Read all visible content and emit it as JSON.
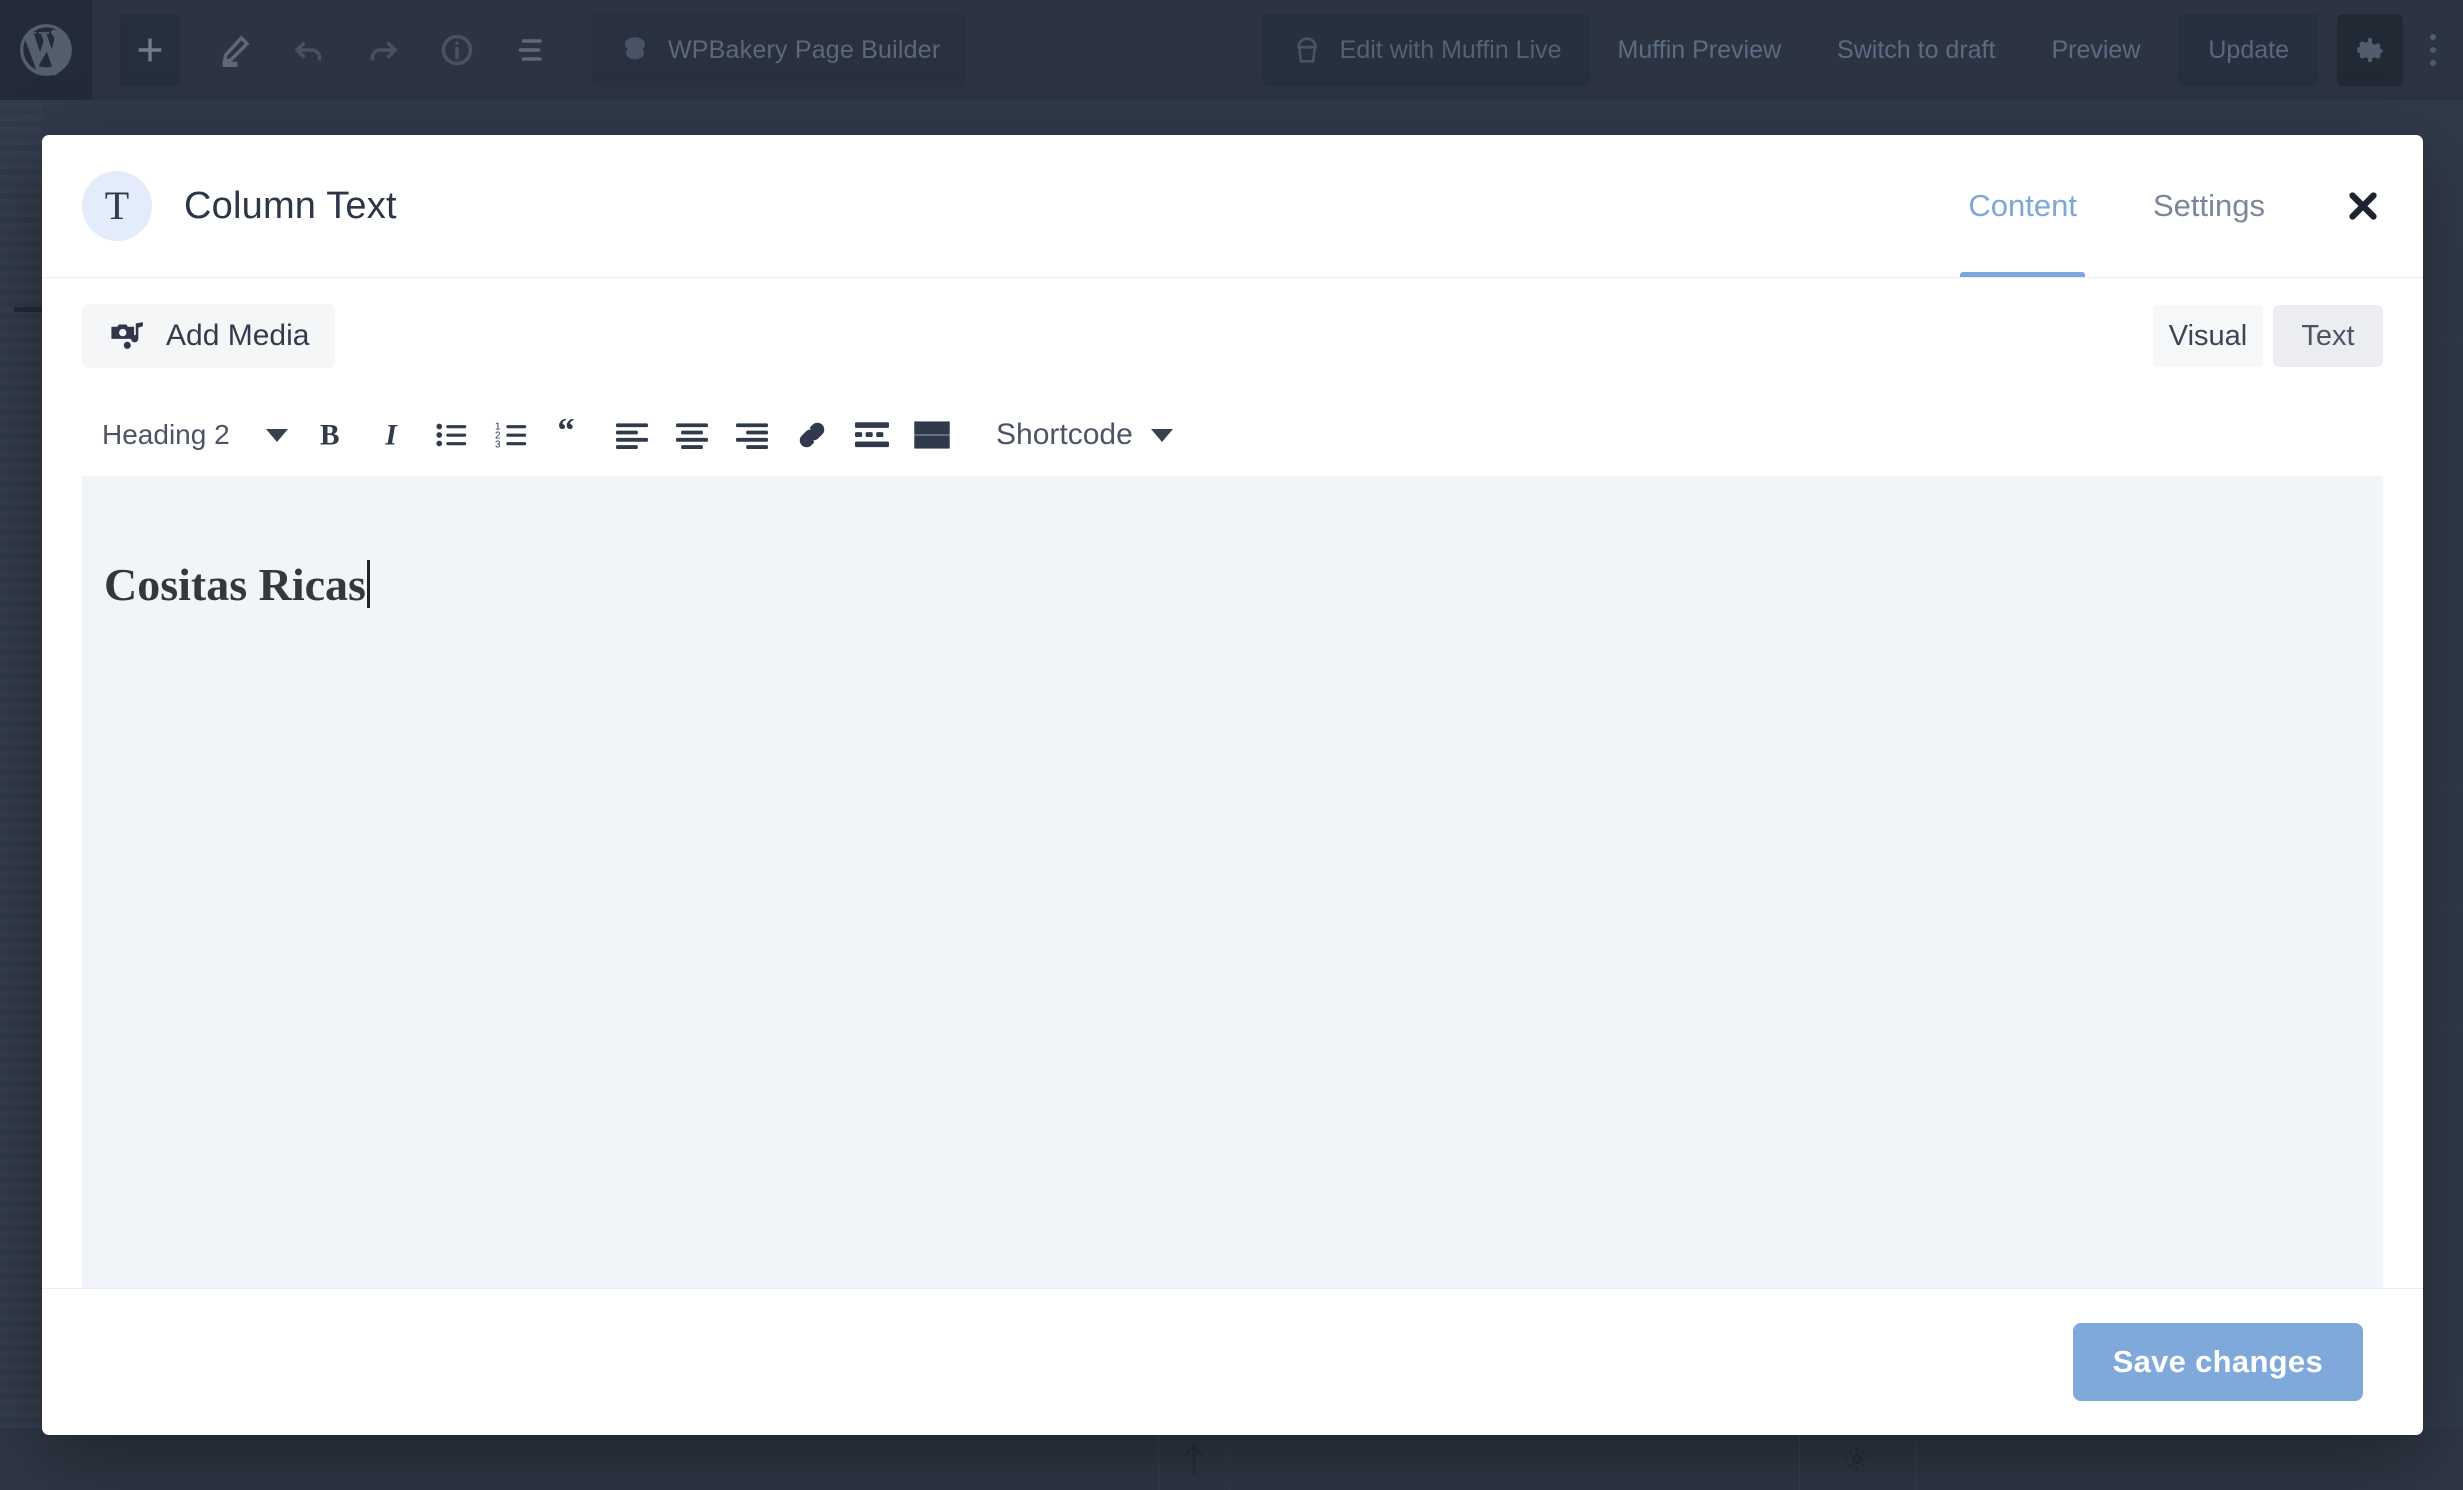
{
  "admin_bar": {
    "logo": "wordpress-logo",
    "icons": [
      "plus-icon",
      "pencil-icon",
      "undo-icon",
      "redo-icon",
      "info-icon",
      "list-view-icon"
    ],
    "page_builder_button": {
      "label": "WPBakery Page Builder",
      "icon": "wpbakery-icon"
    },
    "muffin_live_button": {
      "label": "Edit with Muffin Live",
      "icon": "muffin-icon"
    },
    "links": [
      "Muffin Preview",
      "Switch to draft",
      "Preview"
    ],
    "update_label": "Update",
    "settings_icon": "gear-icon",
    "options_icon": "kebab-menu-icon"
  },
  "modal": {
    "icon_letter": "T",
    "title": "Column Text",
    "tabs": [
      {
        "label": "Content",
        "active": true
      },
      {
        "label": "Settings",
        "active": false
      }
    ],
    "close_icon": "close-icon",
    "toolbar": {
      "add_media_label": "Add Media",
      "add_media_icon": "media-camera-note-icon",
      "mode_buttons": [
        {
          "label": "Visual",
          "active": true
        },
        {
          "label": "Text",
          "active": false
        }
      ]
    },
    "editor_toolbar": {
      "format_select": "Heading 2",
      "buttons": [
        "bold-icon",
        "italic-icon",
        "bulleted-list-icon",
        "numbered-list-icon",
        "blockquote-icon",
        "align-left-icon",
        "align-center-icon",
        "align-right-icon",
        "link-icon",
        "read-more-icon",
        "toolbar-toggle-icon"
      ],
      "shortcode_label": "Shortcode"
    },
    "content": {
      "heading_text": "Cositas Ricas"
    },
    "footer": {
      "save_label": "Save changes"
    }
  },
  "colors": {
    "accent_blue": "#7fa9da",
    "tab_active": "#7ba7db",
    "admin_bar_bg": "#2c3442",
    "overlay_bg": "#313a49",
    "editor_canvas": "#f1f4f9"
  }
}
